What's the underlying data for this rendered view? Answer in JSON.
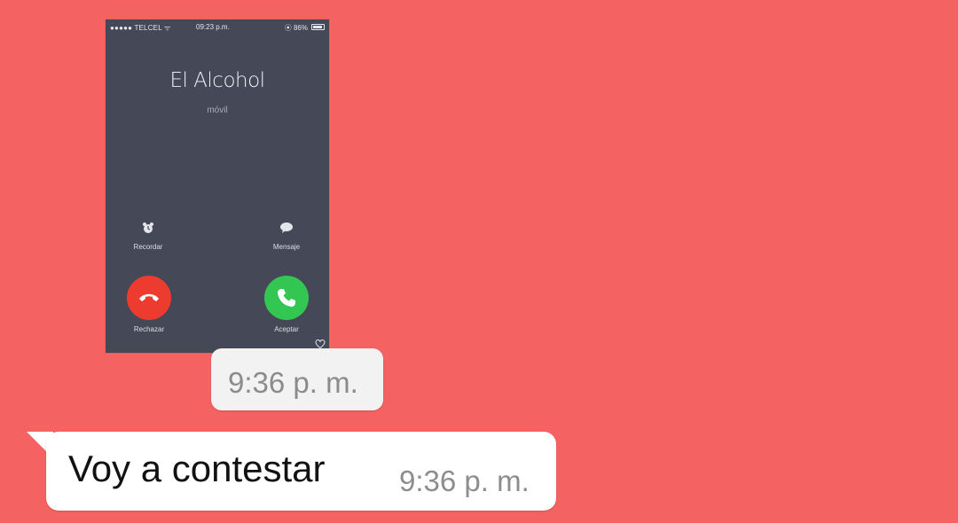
{
  "image_message": {
    "status_bar": {
      "carrier": "●●●●● TELCEL ᯤ",
      "time": "09:23 p.m.",
      "battery": "⦿ 86%"
    },
    "call": {
      "caller_name": "El Alcohol",
      "caller_type": "móvil",
      "remind_label": "Recordar",
      "message_label": "Mensaje",
      "decline_label": "Rechazar",
      "accept_label": "Aceptar"
    },
    "timestamp": "9:36 p. m."
  },
  "text_message": {
    "text": "Voy a contestar",
    "timestamp": "9:36 p. m."
  },
  "colors": {
    "background": "#f46362",
    "decline": "#ee3b2f",
    "accept": "#34c653",
    "phone_screen": "#454856"
  }
}
